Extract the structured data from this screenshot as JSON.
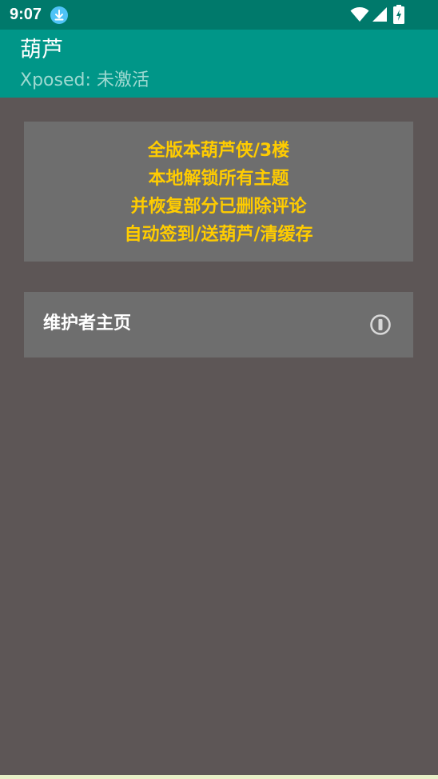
{
  "status_bar": {
    "time": "9:07",
    "icons": [
      "download-icon",
      "wifi-icon",
      "signal-icon",
      "battery-icon"
    ]
  },
  "app_bar": {
    "title": "葫芦",
    "subtitle": "Xposed: 未激活"
  },
  "banner": {
    "lines": [
      "全版本葫芦侠/3楼",
      "本地解锁所有主题",
      "并恢复部分已删除评论",
      "自动签到/送葫芦/清缓存"
    ]
  },
  "maintainer": {
    "label": "维护者主页",
    "icon": "info-icon"
  },
  "colors": {
    "status_bar": "#00796b",
    "app_bar": "#009688",
    "background": "#5d5656",
    "card": "#6e6e6e",
    "banner_text": "#ffcc00"
  }
}
